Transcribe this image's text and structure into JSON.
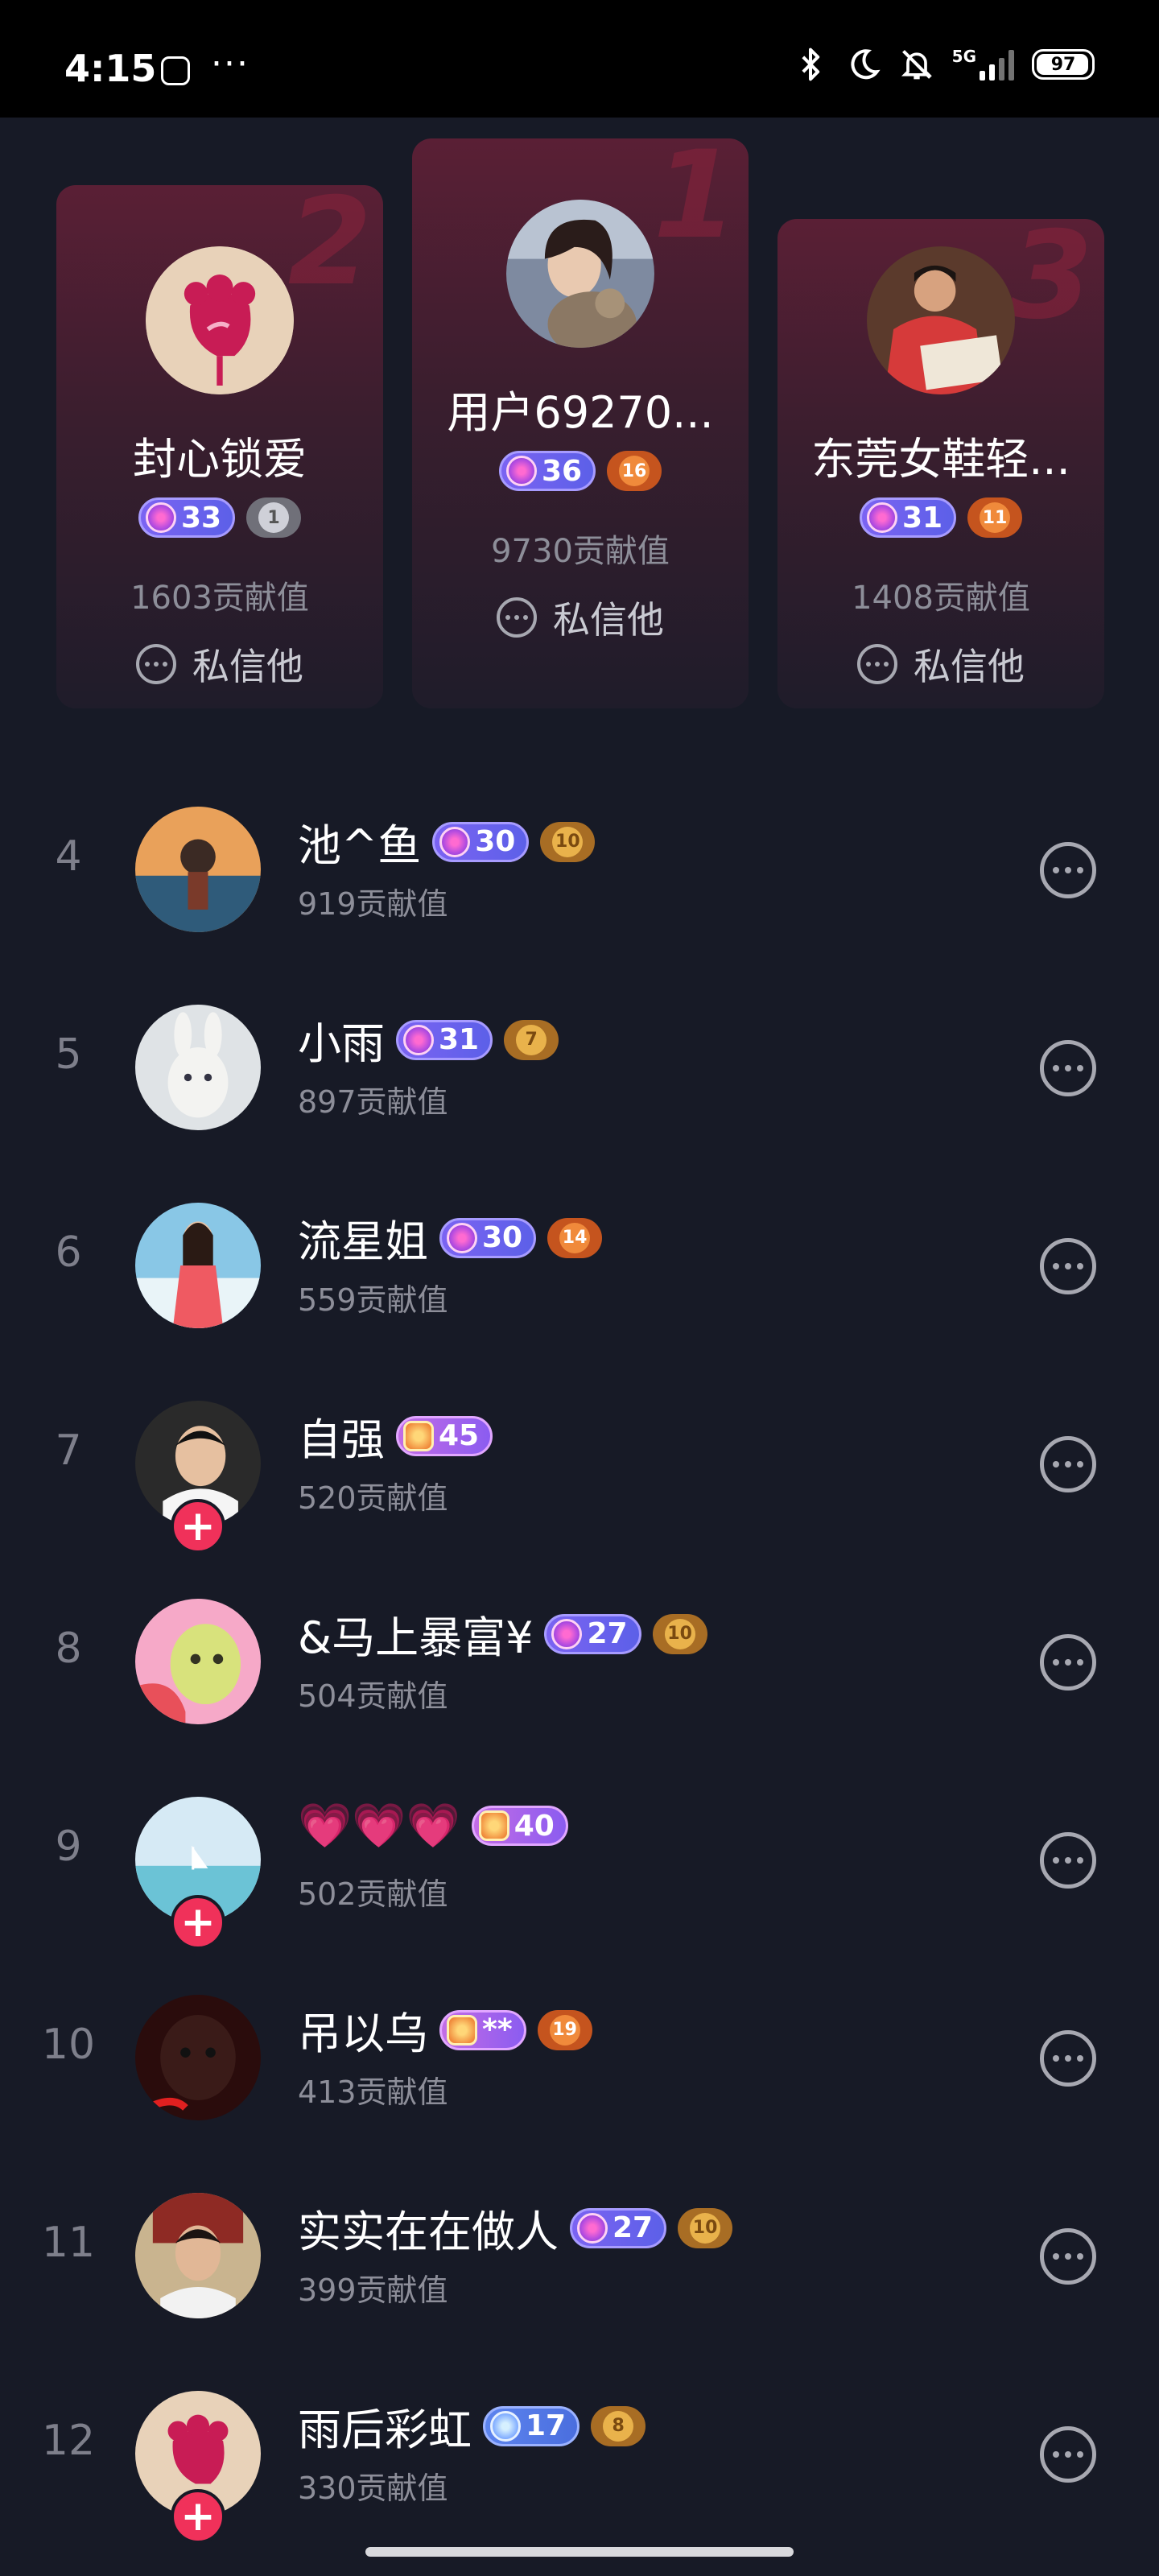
{
  "status_bar": {
    "time": "4:15",
    "more": "···",
    "network": "5G",
    "battery": "97",
    "battery_level_percent": 97
  },
  "podium": [
    {
      "rank": "2",
      "name": "封心锁爱",
      "level": "33",
      "fan_level": "1",
      "fan_style": "silver",
      "value": "1603贡献值",
      "message_label": "私信他"
    },
    {
      "rank": "1",
      "name": "用户69270...",
      "level": "36",
      "fan_level": "16",
      "fan_style": "orange",
      "value": "9730贡献值",
      "message_label": "私信他"
    },
    {
      "rank": "3",
      "name": "东莞女鞋轻...",
      "level": "31",
      "fan_level": "11",
      "fan_style": "orange",
      "value": "1408贡献值",
      "message_label": "私信他"
    }
  ],
  "list": [
    {
      "rank": "4",
      "name": "池^鱼",
      "level": "30",
      "level_style": "purple",
      "fan_level": "10",
      "fan_style": "gold",
      "value": "919贡献值",
      "follow": false
    },
    {
      "rank": "5",
      "name": "小雨",
      "level": "31",
      "level_style": "purple",
      "fan_level": "7",
      "fan_style": "gold",
      "value": "897贡献值",
      "follow": false
    },
    {
      "rank": "6",
      "name": "流星姐",
      "level": "30",
      "level_style": "purple",
      "fan_level": "14",
      "fan_style": "orange",
      "value": "559贡献值",
      "follow": false
    },
    {
      "rank": "7",
      "name": "自强",
      "level": "45",
      "level_style": "gold",
      "fan_level": "",
      "fan_style": "",
      "value": "520贡献值",
      "follow": true
    },
    {
      "rank": "8",
      "name": "&马上暴富¥",
      "level": "27",
      "level_style": "purple",
      "fan_level": "10",
      "fan_style": "gold",
      "value": "504贡献值",
      "follow": false
    },
    {
      "rank": "9",
      "name": "💗💗💗",
      "level": "40",
      "level_style": "gold",
      "fan_level": "",
      "fan_style": "",
      "value": "502贡献值",
      "follow": true
    },
    {
      "rank": "10",
      "name": "吊以乌",
      "level": "**",
      "level_style": "gold",
      "fan_level": "19",
      "fan_style": "orange",
      "value": "413贡献值",
      "follow": false
    },
    {
      "rank": "11",
      "name": "实实在在做人",
      "level": "27",
      "level_style": "purple",
      "fan_level": "10",
      "fan_style": "gold",
      "value": "399贡献值",
      "follow": false
    },
    {
      "rank": "12",
      "name": "雨后彩虹",
      "level": "17",
      "level_style": "blue",
      "fan_level": "8",
      "fan_style": "gold",
      "value": "330贡献值",
      "follow": true
    }
  ],
  "follow_symbol": "+",
  "colors": {
    "background": "#171a26",
    "podium_top": "#5a1f35",
    "follow_button": "#f0315a",
    "secondary_text": "#8d8e99"
  }
}
